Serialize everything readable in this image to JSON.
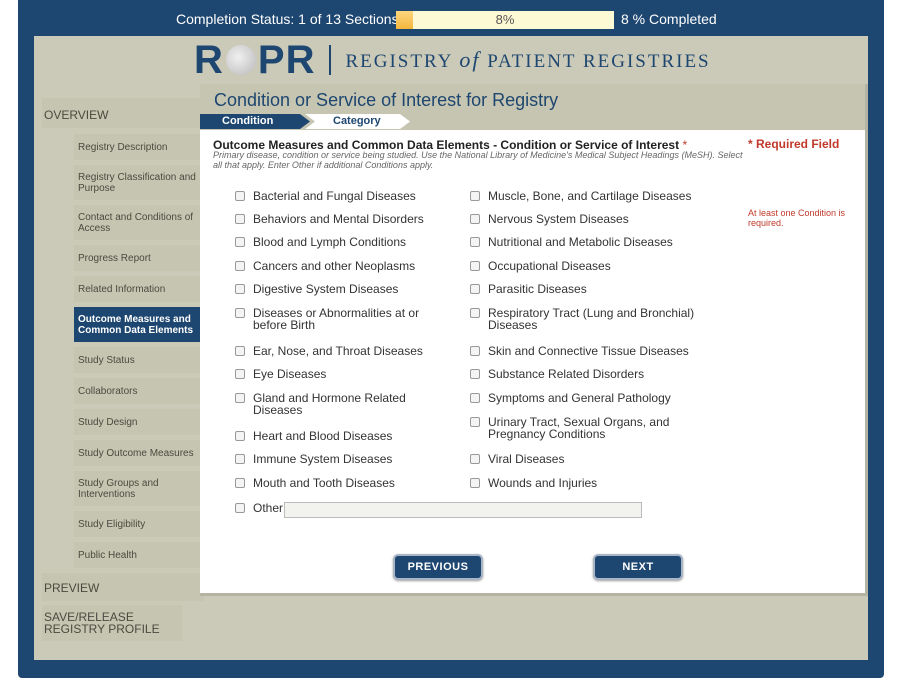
{
  "status_bar": {
    "label": "Completion Status: 1 of 13 Sections",
    "progress_text": "8%",
    "progress_fraction": 0.08,
    "completed_text": "8 % Completed"
  },
  "logo": {
    "mark_r": "R",
    "mark_pr": "PR",
    "text_before": "REGISTRY",
    "text_of": "of",
    "text_after": "PATIENT REGISTRIES"
  },
  "sidebar": {
    "overview": "OVERVIEW",
    "items": [
      "Registry Description",
      "Registry Classification and Purpose",
      "Contact and Conditions of Access",
      "Progress Report",
      "Related Information",
      "Outcome Measures and Common Data Elements",
      "Study Status",
      "Collaborators",
      "Study Design",
      "Study Outcome Measures",
      "Study Groups and Interventions",
      "Study Eligibility",
      "Public Health"
    ],
    "preview": "PREVIEW",
    "save_release": "SAVE/RELEASE REGISTRY PROFILE"
  },
  "page": {
    "title": "Condition or Service of Interest for Registry",
    "steps": [
      "Condition",
      "Category"
    ],
    "question_title": "Outcome Measures and Common Data Elements - Condition or Service of Interest",
    "required_star": "*",
    "help_text": "Primary disease, condition or service being studied. Use the National Library of Medicine's Medical Subject Headings (MeSH). Select all that apply. Enter Other if additional Conditions apply.",
    "required_field": "* Required Field",
    "required_note": "At least one Condition is required."
  },
  "conditions": {
    "col1": [
      "Bacterial and Fungal Diseases",
      "Behaviors and Mental Disorders",
      "Blood and Lymph Conditions",
      "Cancers and other Neoplasms",
      "Digestive System Diseases",
      "Diseases or Abnormalities at or before Birth",
      "Ear, Nose, and Throat Diseases",
      "Eye Diseases",
      "Gland and Hormone Related Diseases",
      "Heart and Blood Diseases",
      "Immune System Diseases",
      "Mouth and Tooth Diseases"
    ],
    "col2": [
      "Muscle, Bone, and Cartilage Diseases",
      "Nervous System Diseases",
      "Nutritional and Metabolic Diseases",
      "Occupational Diseases",
      "Parasitic Diseases",
      "Respiratory Tract (Lung and Bronchial) Diseases",
      "Skin and Connective Tissue Diseases",
      "Substance Related Disorders",
      "Symptoms and General Pathology",
      "Urinary Tract, Sexual Organs, and Pregnancy Conditions",
      "Viral Diseases",
      "Wounds and Injuries"
    ],
    "other_label": "Other",
    "other_value": ""
  },
  "buttons": {
    "previous": "PREVIOUS",
    "next": "NEXT"
  }
}
